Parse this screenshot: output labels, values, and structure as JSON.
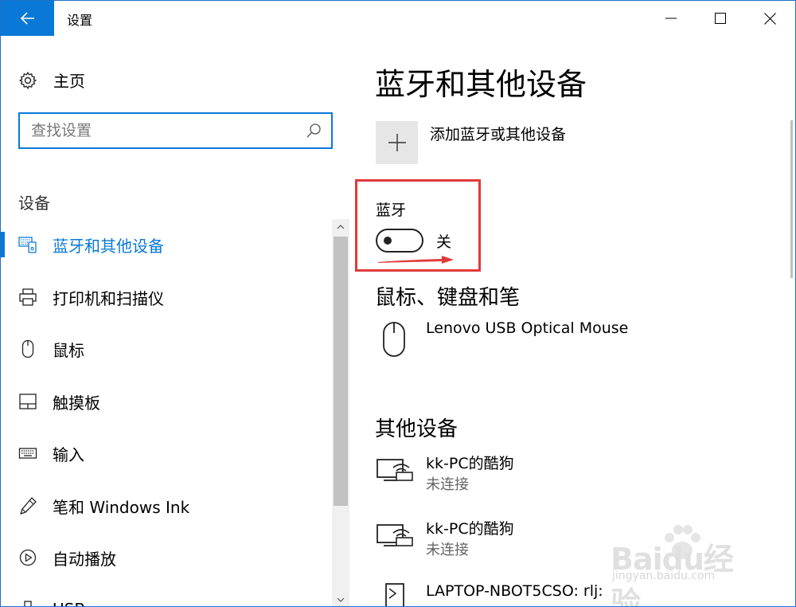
{
  "window": {
    "title": "设置",
    "back_icon": "back-arrow-icon",
    "controls": [
      "minimize",
      "maximize",
      "close"
    ]
  },
  "sidebar": {
    "home_label": "主页",
    "search_placeholder": "查找设置",
    "section_heading": "设备",
    "items": [
      {
        "label": "蓝牙和其他设备",
        "icon": "bluetooth-devices-icon",
        "active": true
      },
      {
        "label": "打印机和扫描仪",
        "icon": "printer-icon",
        "active": false
      },
      {
        "label": "鼠标",
        "icon": "mouse-icon",
        "active": false
      },
      {
        "label": "触摸板",
        "icon": "touchpad-icon",
        "active": false
      },
      {
        "label": "输入",
        "icon": "keyboard-icon",
        "active": false
      },
      {
        "label": "笔和 Windows Ink",
        "icon": "pen-icon",
        "active": false
      },
      {
        "label": "自动播放",
        "icon": "autoplay-icon",
        "active": false
      },
      {
        "label": "USB",
        "icon": "usb-icon",
        "active": false
      }
    ]
  },
  "main": {
    "title": "蓝牙和其他设备",
    "add_device_label": "添加蓝牙或其他设备",
    "bluetooth": {
      "label": "蓝牙",
      "state_label": "关",
      "on": false
    },
    "mouse_section": {
      "heading": "鼠标、键盘和笔",
      "devices": [
        {
          "name": "Lenovo USB Optical Mouse"
        }
      ]
    },
    "other_section": {
      "heading": "其他设备",
      "devices": [
        {
          "name": "kk-PC的酷狗",
          "status": "未连接"
        },
        {
          "name": "kk-PC的酷狗",
          "status": "未连接"
        },
        {
          "name": "LAPTOP-NBOT5CSO: rlj:"
        }
      ]
    }
  },
  "watermark": {
    "brand": "Baidu经验",
    "url": "jingyan.baidu.com"
  },
  "colors": {
    "accent": "#0a78d7",
    "highlight_box": "#e03a3a"
  }
}
